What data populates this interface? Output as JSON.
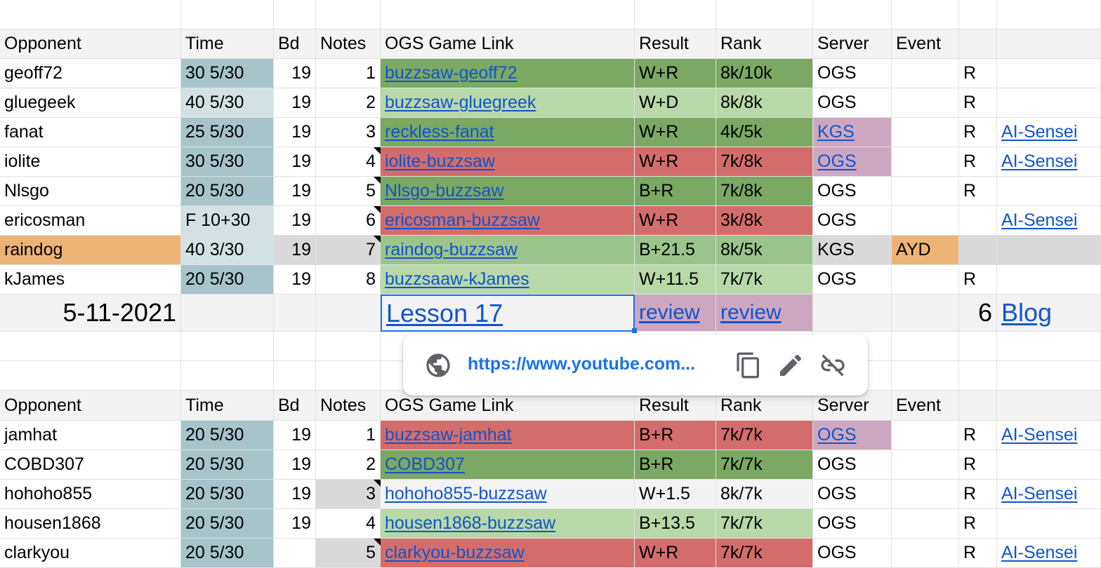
{
  "colors": {
    "time_dark": "#a6c4ca",
    "time_light": "#d4e1e4",
    "win_dark": "#7ba862",
    "win_light": "#b8d8a8",
    "win_mid": "#9bc48a",
    "loss": "#d36d6b",
    "server_purple": "#cda7c0",
    "raindog_orange": "#edb374",
    "grey": "#d9d9d9",
    "light_grey": "#f3f3f3",
    "link": "#1155cc",
    "selection": "#1a73e8"
  },
  "table1": {
    "headers": [
      "Opponent",
      "Time",
      "Bd",
      "Notes",
      "OGS Game Link",
      "Result",
      "Rank",
      "Server",
      "Event",
      "",
      ""
    ],
    "rows": [
      [
        "geoff72",
        "30 5/30",
        "19",
        "1",
        "buzzsaw-geoff72",
        "W+R",
        "8k/10k",
        "OGS",
        "",
        "R",
        ""
      ],
      [
        "gluegeek",
        "40 5/30",
        "19",
        "2",
        "buzzsaw-gluegreek",
        "W+D",
        "8k/8k",
        "OGS",
        "",
        "R",
        ""
      ],
      [
        "fanat",
        "25 5/30",
        "19",
        "3",
        "reckless-fanat",
        "W+R",
        "4k/5k",
        "KGS",
        "",
        "R",
        "AI-Sensei"
      ],
      [
        "iolite",
        "30 5/30",
        "19",
        "4",
        "iolite-buzzsaw",
        "W+R",
        "7k/8k",
        "OGS",
        "",
        "R",
        "AI-Sensei"
      ],
      [
        "Nlsgo",
        "20 5/30",
        "19",
        "5",
        "Nlsgo-buzzsaw",
        "B+R",
        "7k/8k",
        "OGS",
        "",
        "R",
        ""
      ],
      [
        "ericosman",
        "F 10+30",
        "19",
        "6",
        "ericosman-buzzsaw",
        "W+R",
        "3k/8k",
        "OGS",
        "",
        "",
        "AI-Sensei"
      ],
      [
        "raindog",
        "40 3/30",
        "19",
        "7",
        "raindog-buzzsaw",
        "B+21.5",
        "8k/5k",
        "KGS",
        "AYD",
        "",
        ""
      ],
      [
        "kJames",
        "20 5/30",
        "19",
        "8",
        "buzzsaaw-kJames",
        "W+11.5",
        "7k/7k",
        "OGS",
        "",
        "R",
        ""
      ]
    ],
    "summary": [
      "5-11-2021",
      "",
      "",
      "",
      "Lesson 17",
      "review",
      "review",
      "",
      "",
      "6",
      "Blog"
    ]
  },
  "table2": {
    "headers": [
      "Opponent",
      "Time",
      "Bd",
      "Notes",
      "OGS Game Link",
      "Result",
      "Rank",
      "Server",
      "Event",
      "",
      ""
    ],
    "rows": [
      [
        "jamhat",
        "20 5/30",
        "19",
        "1",
        "buzzsaw-jamhat",
        "B+R",
        "7k/7k",
        "OGS",
        "",
        "R",
        "AI-Sensei"
      ],
      [
        "COBD307",
        "20 5/30",
        "19",
        "2",
        "COBD307",
        "B+R",
        "7k/7k",
        "OGS",
        "",
        "R",
        ""
      ],
      [
        "hohoho855",
        "20 5/30",
        "19",
        "3",
        "hohoho855-buzzsaw",
        "W+1.5",
        "8k/7k",
        "OGS",
        "",
        "R",
        "AI-Sensei"
      ],
      [
        "housen1868",
        "20 5/30",
        "19",
        "4",
        "housen1868-buzzsaw",
        "B+13.5",
        "7k/7k",
        "OGS",
        "",
        "R",
        ""
      ],
      [
        "clarkyou",
        "20 5/30",
        "",
        "5",
        "clarkyou-buzzsaw",
        "W+R",
        "7k/7k",
        "OGS",
        "",
        "R",
        "AI-Sensei"
      ]
    ]
  },
  "link_popup": {
    "url": "https://www.youtube.com...",
    "icons": [
      "globe-icon",
      "copy-icon",
      "edit-icon",
      "unlink-icon"
    ]
  }
}
